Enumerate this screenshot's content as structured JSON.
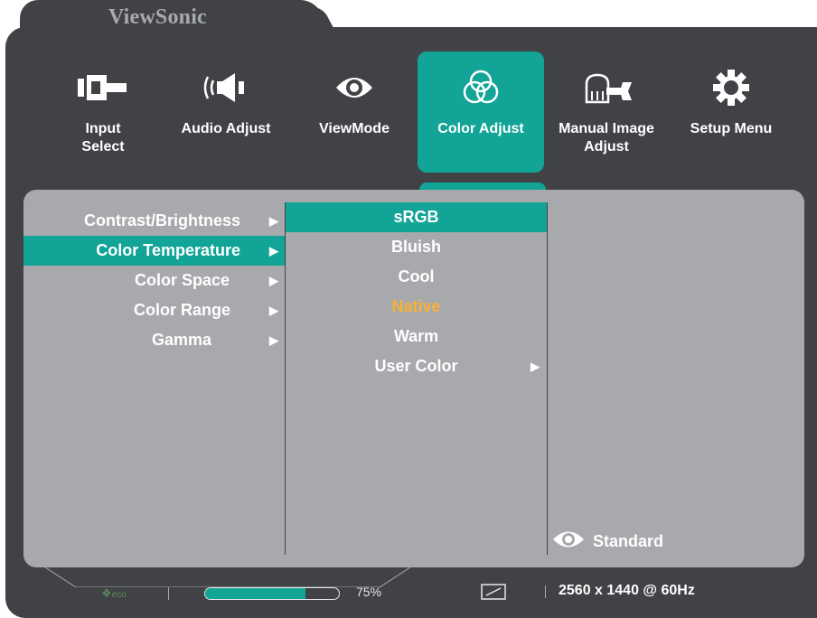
{
  "brand": "ViewSonic",
  "tabs": [
    {
      "label": "Input\nSelect",
      "icon": "input-select-icon"
    },
    {
      "label": "Audio Adjust",
      "icon": "speaker-icon"
    },
    {
      "label": "ViewMode",
      "icon": "eye-icon"
    },
    {
      "label": "Color Adjust",
      "icon": "color-circles-icon",
      "active": true
    },
    {
      "label": "Manual Image\nAdjust",
      "icon": "hand-wrench-icon"
    },
    {
      "label": "Setup Menu",
      "icon": "gear-icon"
    }
  ],
  "menu": {
    "items": [
      {
        "label": "Contrast/Brightness",
        "arrow": "▶"
      },
      {
        "label": "Color Temperature",
        "arrow": "▶",
        "selected": true
      },
      {
        "label": "Color Space",
        "arrow": "▶"
      },
      {
        "label": "Color Range",
        "arrow": "▶"
      },
      {
        "label": "Gamma",
        "arrow": "▶"
      }
    ]
  },
  "submenu": {
    "items": [
      {
        "label": "sRGB",
        "selected": true
      },
      {
        "label": "Bluish"
      },
      {
        "label": "Cool"
      },
      {
        "label": "Native",
        "current": true
      },
      {
        "label": "Warm"
      },
      {
        "label": "User Color",
        "arrow": "▶"
      }
    ]
  },
  "view_mode": {
    "label": "Standard",
    "icon": "eye-icon"
  },
  "status": {
    "eco_label": "eco",
    "progress_percent": 75,
    "progress_text": "75%",
    "aspect_icon": "aspect-ratio-icon",
    "resolution": "2560 x 1440 @ 60Hz"
  },
  "colors": {
    "accent": "#12a497",
    "frame": "#404246",
    "panel": "#a7a9ac",
    "current_value": "#f9b233"
  }
}
